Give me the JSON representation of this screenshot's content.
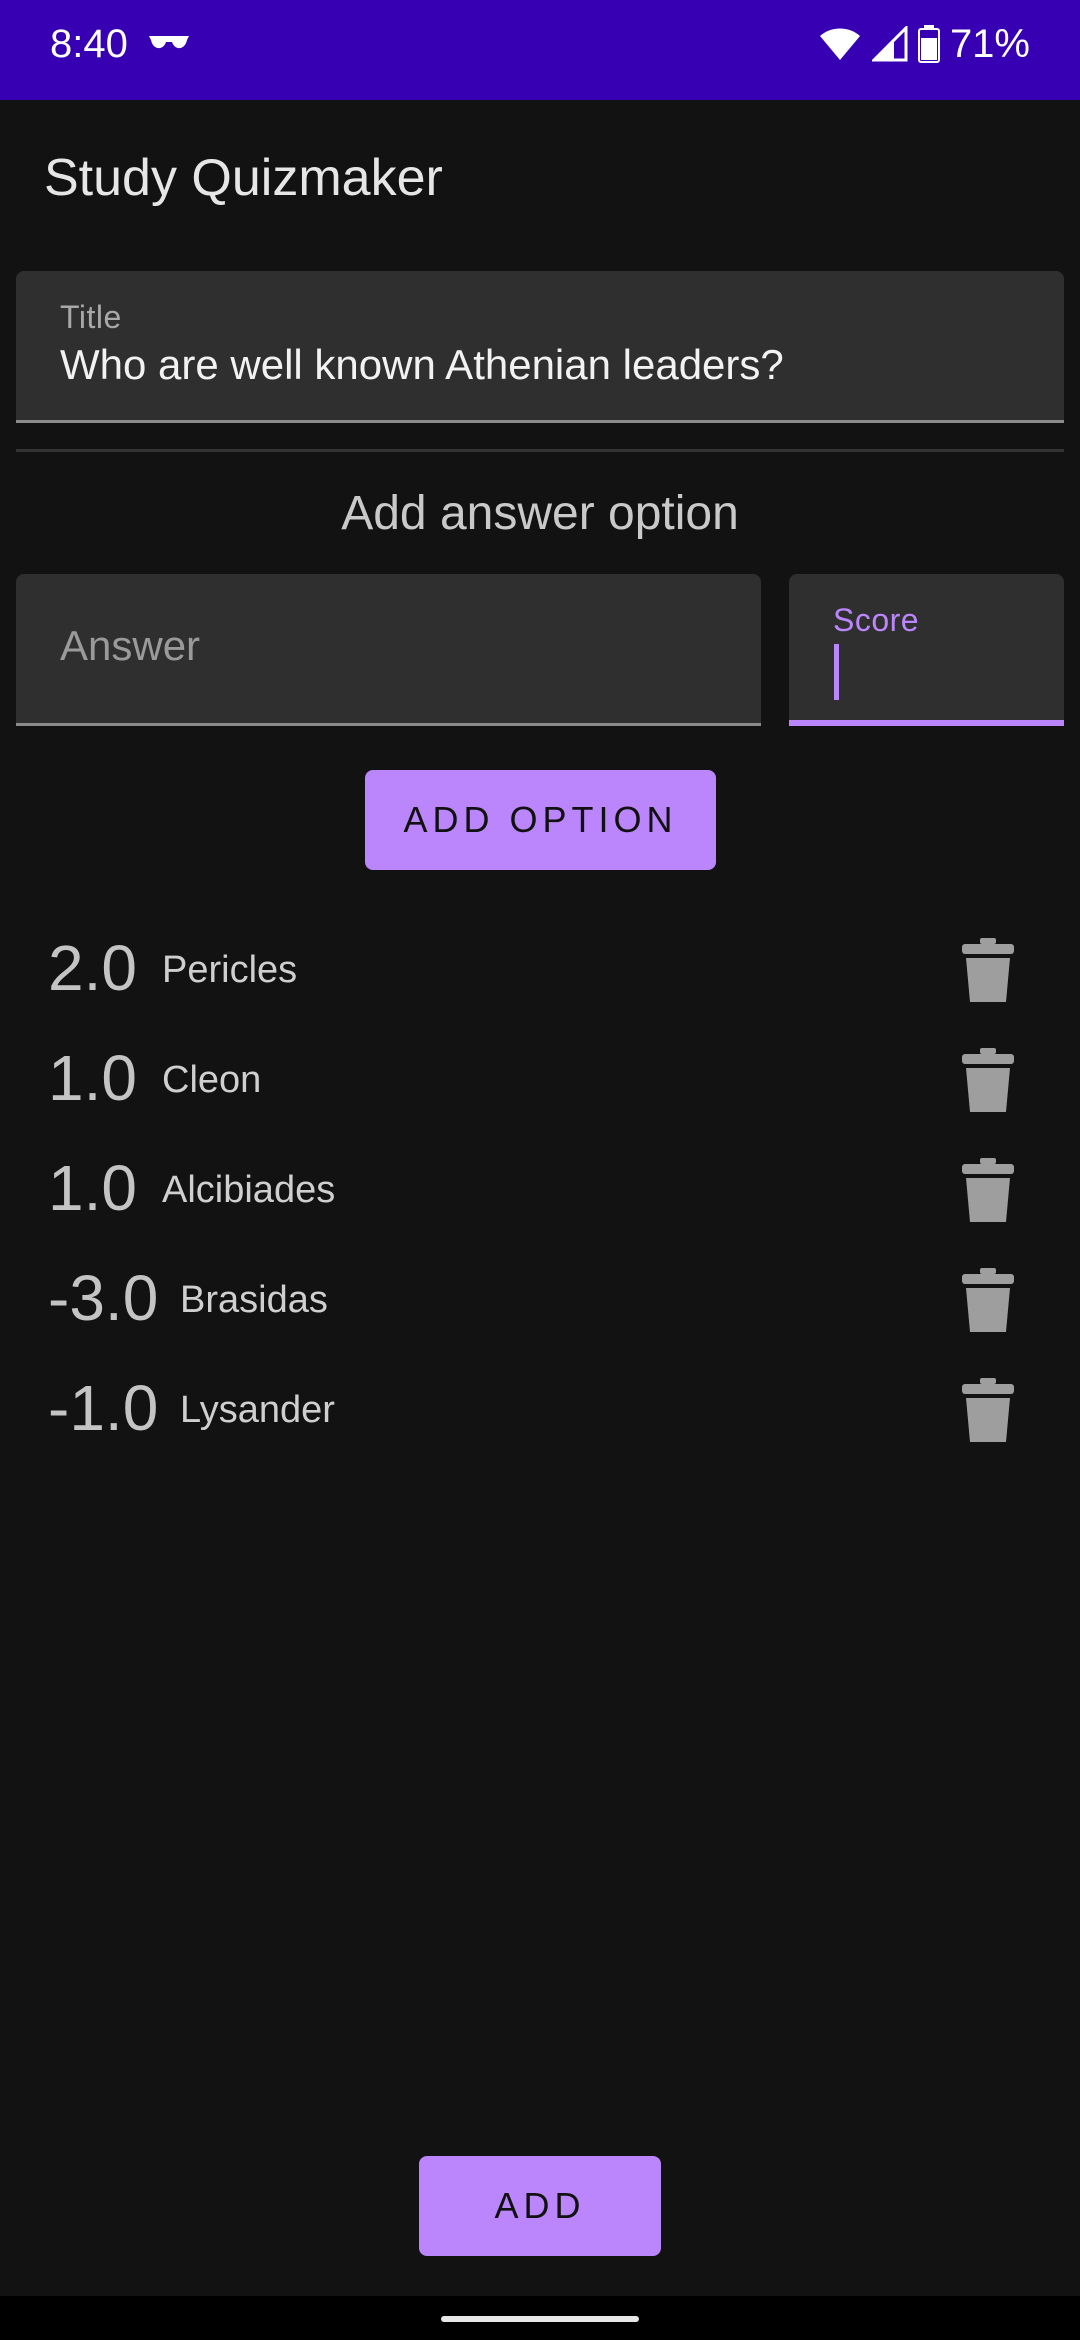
{
  "status_bar": {
    "time": "8:40",
    "battery": "71%"
  },
  "app": {
    "title": "Study Quizmaker"
  },
  "form": {
    "title_label": "Title",
    "title_value": "Who are well known Athenian leaders?",
    "section_heading": "Add answer option",
    "answer_placeholder": "Answer",
    "score_label": "Score",
    "add_option_label": "ADD OPTION",
    "add_label": "ADD"
  },
  "options": [
    {
      "score": "2.0",
      "answer": "Pericles"
    },
    {
      "score": "1.0",
      "answer": "Cleon"
    },
    {
      "score": "1.0",
      "answer": "Alcibiades"
    },
    {
      "score": "-3.0",
      "answer": "Brasidas"
    },
    {
      "score": "-1.0",
      "answer": "Lysander"
    }
  ],
  "colors": {
    "status_bar": "#3700B3",
    "accent": "#BB86FC",
    "background": "#121212"
  }
}
